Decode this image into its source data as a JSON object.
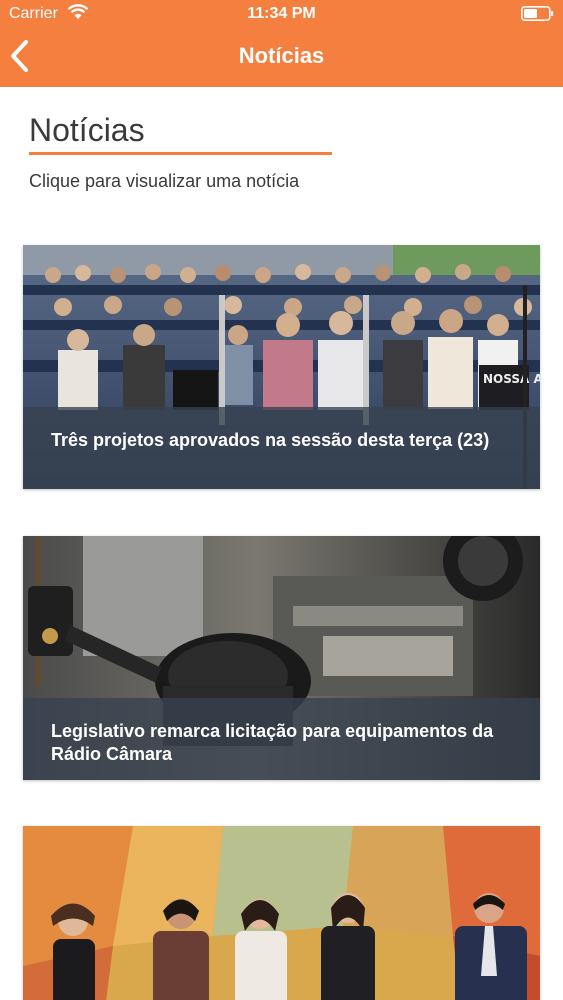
{
  "status_bar": {
    "carrier": "Carrier",
    "time": "11:34 PM"
  },
  "nav": {
    "title": "Notícias"
  },
  "header": {
    "title": "Notícias",
    "subtitle": "Clique para visualizar uma notícia"
  },
  "news": [
    {
      "title": "Três projetos aprovados na sessão desta terça (23)",
      "banner_text": "NOSSA AGRAD"
    },
    {
      "title": "Legislativo remarca licitação para equipamentos da Rádio Câmara"
    },
    {
      "title": ""
    }
  ],
  "colors": {
    "accent": "#f47f3f",
    "caption_overlay": "#374150",
    "text": "#3a3a3a"
  }
}
